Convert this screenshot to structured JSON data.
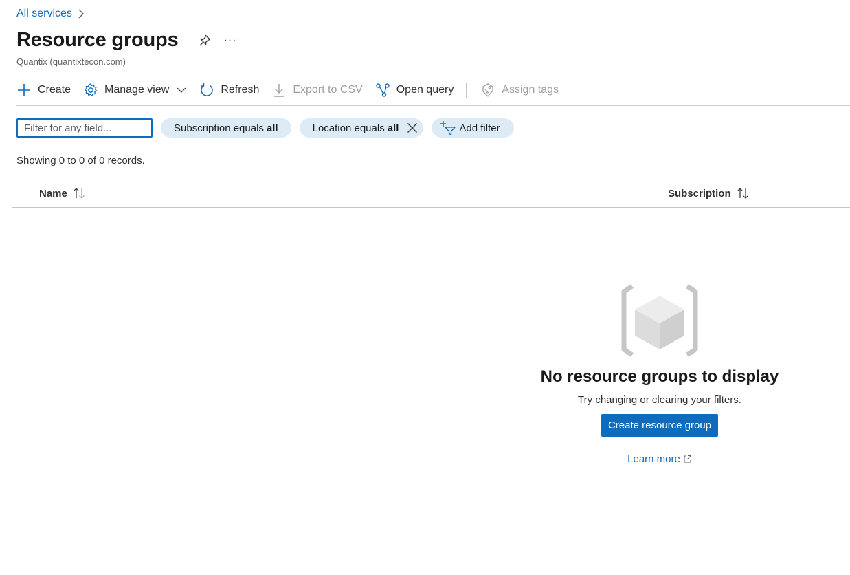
{
  "breadcrumb": {
    "label": "All services"
  },
  "header": {
    "title": "Resource groups",
    "tenant": "Quantix (quantixtecon.com)",
    "more_label": "···"
  },
  "toolbar": {
    "create": "Create",
    "manage_view": "Manage view",
    "refresh": "Refresh",
    "export_csv": "Export to CSV",
    "open_query": "Open query",
    "assign_tags": "Assign tags"
  },
  "filters": {
    "placeholder": "Filter for any field...",
    "subscription": {
      "label": "Subscription equals",
      "value": "all"
    },
    "location": {
      "label": "Location equals",
      "value": "all"
    },
    "add_filter": "Add filter"
  },
  "records_text": "Showing 0 to 0 of 0 records.",
  "table": {
    "columns": [
      "Name",
      "Subscription"
    ]
  },
  "empty_state": {
    "title": "No resource groups to display",
    "subtitle": "Try changing or clearing your filters.",
    "button": "Create resource group",
    "learn_more": "Learn more"
  },
  "colors": {
    "accent": "#0f6cbd",
    "pill": "#ddebf7",
    "disabled": "#a19f9d"
  },
  "icons": [
    "chevron-right-icon",
    "pin-icon",
    "more-icon",
    "plus-icon",
    "gear-icon",
    "chevron-down-icon",
    "refresh-icon",
    "download-icon",
    "query-icon",
    "tag-icon",
    "close-icon",
    "add-filter-icon",
    "sort-icon",
    "resource-group-icon",
    "external-link-icon"
  ]
}
